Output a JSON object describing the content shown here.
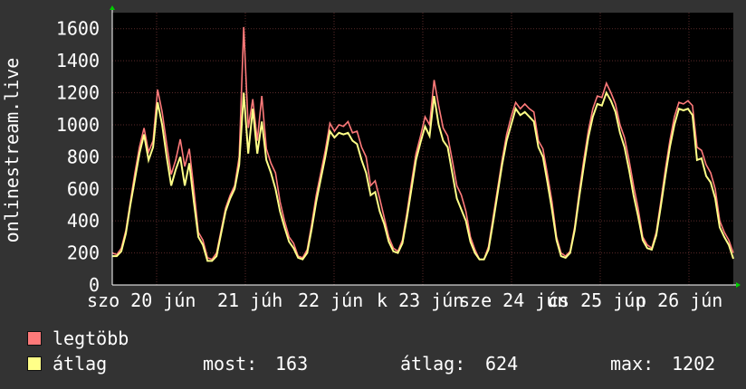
{
  "chart_data": {
    "type": "line",
    "ylabel": "onlinestream.live",
    "ylim": [
      0,
      1700
    ],
    "yticks": [
      0,
      200,
      400,
      600,
      800,
      1000,
      1200,
      1400,
      1600
    ],
    "xtick_labels": [
      "szo 20 jún",
      "21 júh",
      "22 jún",
      "k 23 jún",
      "sze 24 jún",
      "cs 25 jún",
      "p 26 jún"
    ],
    "grid": true,
    "colors": {
      "background": "#000000",
      "grid": "#5a2a2a",
      "axis": "#ffffff",
      "arrow": "#00cc00"
    },
    "series": [
      {
        "name": "legtöbb",
        "color": "#ff7a7a",
        "values": [
          200,
          190,
          230,
          340,
          520,
          700,
          860,
          980,
          830,
          900,
          1220,
          1080,
          880,
          690,
          780,
          910,
          740,
          850,
          600,
          330,
          280,
          170,
          160,
          200,
          340,
          480,
          560,
          620,
          800,
          1610,
          980,
          1160,
          900,
          1180,
          850,
          760,
          700,
          520,
          400,
          300,
          260,
          180,
          170,
          220,
          380,
          560,
          700,
          840,
          1010,
          960,
          1000,
          990,
          1020,
          950,
          960,
          860,
          800,
          620,
          650,
          540,
          420,
          300,
          230,
          210,
          280,
          450,
          640,
          820,
          930,
          1050,
          1000,
          1280,
          1120,
          980,
          930,
          780,
          620,
          560,
          460,
          300,
          220,
          160,
          160,
          240,
          420,
          600,
          780,
          940,
          1050,
          1140,
          1100,
          1130,
          1100,
          1080,
          900,
          850,
          690,
          520,
          300,
          200,
          180,
          210,
          360,
          580,
          780,
          960,
          1100,
          1180,
          1170,
          1260,
          1200,
          1130,
          1000,
          920,
          780,
          620,
          480,
          300,
          250,
          230,
          330,
          520,
          720,
          900,
          1050,
          1140,
          1130,
          1150,
          1120,
          860,
          840,
          750,
          700,
          600,
          400,
          330,
          280,
          200
        ]
      },
      {
        "name": "átlag",
        "color": "#ffff88",
        "values": [
          180,
          180,
          210,
          320,
          500,
          660,
          820,
          940,
          780,
          860,
          1140,
          1000,
          800,
          620,
          720,
          800,
          620,
          760,
          520,
          300,
          250,
          150,
          150,
          180,
          320,
          460,
          540,
          600,
          750,
          1200,
          820,
          1100,
          820,
          1020,
          780,
          700,
          600,
          460,
          360,
          270,
          230,
          170,
          160,
          200,
          350,
          520,
          660,
          800,
          960,
          920,
          950,
          940,
          950,
          900,
          880,
          780,
          700,
          560,
          580,
          460,
          380,
          270,
          210,
          200,
          260,
          420,
          600,
          780,
          890,
          990,
          930,
          1180,
          1000,
          900,
          860,
          700,
          540,
          470,
          400,
          270,
          200,
          160,
          160,
          220,
          390,
          570,
          750,
          900,
          1000,
          1100,
          1060,
          1080,
          1050,
          1020,
          860,
          800,
          640,
          470,
          280,
          180,
          170,
          200,
          340,
          550,
          740,
          920,
          1050,
          1130,
          1120,
          1200,
          1150,
          1080,
          950,
          860,
          720,
          560,
          430,
          280,
          230,
          220,
          310,
          490,
          680,
          860,
          1000,
          1100,
          1090,
          1100,
          1060,
          780,
          790,
          680,
          640,
          540,
          360,
          300,
          250,
          163
        ]
      }
    ],
    "stats": {
      "most_label": "most:",
      "most_value": "163",
      "atlag_label": "átlag:",
      "atlag_value": "624",
      "max_label": "max:",
      "max_value": "1202"
    }
  }
}
